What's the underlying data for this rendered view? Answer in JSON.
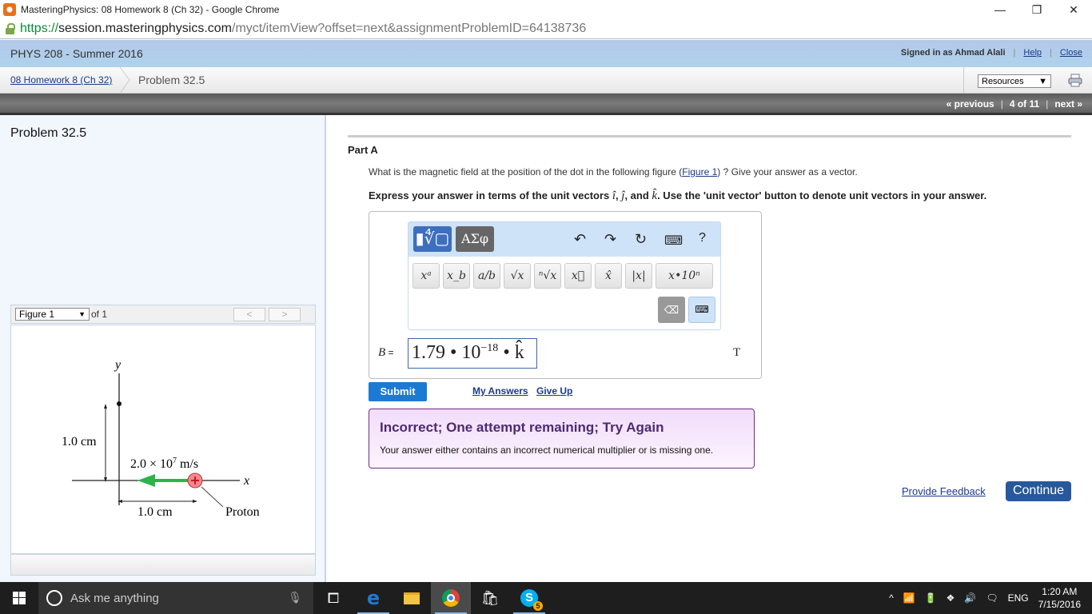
{
  "window": {
    "title": "MasteringPhysics: 08 Homework 8 (Ch 32) - Google Chrome",
    "minimize": "—",
    "restore": "❐",
    "close": "✕"
  },
  "address": {
    "proto": "https://",
    "host": "session.masteringphysics.com",
    "path": "/myct/itemView?offset=next&assignmentProblemID=64138736"
  },
  "header": {
    "course": "PHYS 208 - Summer 2016",
    "signed_in": "Signed in as Ahmad Alali",
    "help": "Help",
    "close": "Close"
  },
  "breadcrumb": {
    "assignment": "08 Homework 8 (Ch 32)",
    "problem": "Problem 32.5",
    "resources": "Resources"
  },
  "nav": {
    "previous": "« previous",
    "position": "4 of 11",
    "next": "next »"
  },
  "left": {
    "title": "Problem 32.5",
    "figure_select": "Figure 1",
    "of": "of 1",
    "prev": "<",
    "next": ">",
    "figure": {
      "y_label": "y",
      "x_label": "x",
      "vertical_dim": "1.0 cm",
      "horizontal_dim": "1.0 cm",
      "velocity_label": "2.0 × 10",
      "velocity_exp": "7",
      "velocity_unit": " m/s",
      "particle_label": "Proton",
      "particle_sign": "+",
      "arrow_color": "#2db34a",
      "proton_color": "#f08a8a"
    }
  },
  "main": {
    "part": "Part A",
    "question_pre": "What is the magnetic field at the position of the dot in the following figure (",
    "question_link": "Figure 1",
    "question_post": ") ? Give your answer as a vector.",
    "instr_pre": "Express your answer in terms of the unit vectors ",
    "instr_i": "î",
    "instr_sep1": ", ",
    "instr_j": "ĵ",
    "instr_sep2": ", and ",
    "instr_k": "k̂",
    "instr_post": ". Use the 'unit vector' button to denote unit vectors in your answer.",
    "toolbar": {
      "templates": "▮∜▢",
      "greek": "ΑΣφ",
      "undo": "↶",
      "redo": "↷",
      "reset": "↻",
      "keyboard": "⌨",
      "help": "?",
      "keys": [
        "xᵃ",
        "x_b",
        "a/b",
        "√x",
        "ⁿ√x",
        "x⃗",
        "x̂",
        "|x|",
        "x•10ⁿ"
      ],
      "backspace": "⌫",
      "show_keyboard": "⌨"
    },
    "answer": {
      "label": "B",
      "equals": " =",
      "mantissa": "1.79 • 10",
      "exponent": "−18",
      "vector": " • k̂",
      "unit": "T"
    },
    "submit": "Submit",
    "my_answers": "My Answers",
    "give_up": "Give Up",
    "feedback": {
      "heading": "Incorrect; One attempt remaining; Try Again",
      "message": "Your answer either contains an incorrect numerical multiplier or is missing one."
    },
    "provide_feedback": "Provide Feedback",
    "continue": "Continue"
  },
  "taskbar": {
    "search_placeholder": "Ask me anything",
    "skype_badge": "5",
    "language": "ENG",
    "time": "1:20 AM",
    "date": "7/15/2016"
  }
}
